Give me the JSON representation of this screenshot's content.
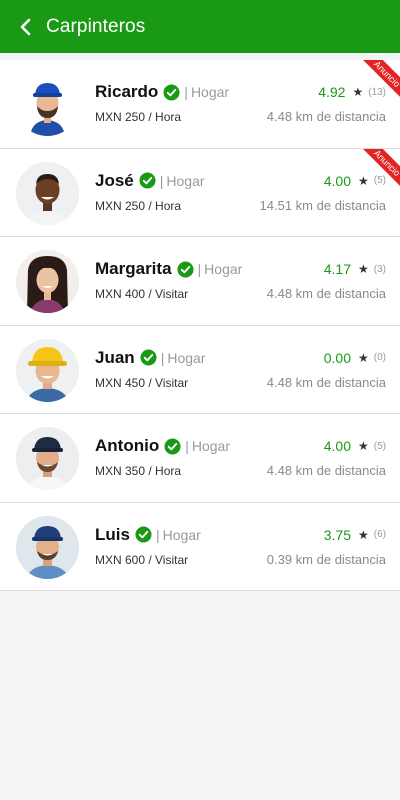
{
  "appbar": {
    "title": "Carpinteros"
  },
  "colors": {
    "brand_green": "#1a9a14",
    "ribbon_red": "#e32424"
  },
  "providers": [
    {
      "name": "Ricardo",
      "category": "Hogar",
      "separator": "|",
      "price": "MXN 250 / Hora",
      "score": "4.92",
      "star": "★",
      "count": "(13)",
      "distance": "4.48 km de distancia",
      "ribbon": "Anuncio"
    },
    {
      "name": "José",
      "category": "Hogar",
      "separator": "|",
      "price": "MXN 250 / Hora",
      "score": "4.00",
      "star": "★",
      "count": "(5)",
      "distance": "14.51 km de distancia",
      "ribbon": "Anuncio"
    },
    {
      "name": "Margarita",
      "category": "Hogar",
      "separator": "|",
      "price": "MXN 400 / Visitar",
      "score": "4.17",
      "star": "★",
      "count": "(3)",
      "distance": "4.48 km de distancia"
    },
    {
      "name": "Juan",
      "category": "Hogar",
      "separator": "|",
      "price": "MXN 450 / Visitar",
      "score": "0.00",
      "star": "★",
      "count": "(0)",
      "distance": "4.48 km de distancia"
    },
    {
      "name": "Antonio",
      "category": "Hogar",
      "separator": "|",
      "price": "MXN 350 / Hora",
      "score": "4.00",
      "star": "★",
      "count": "(5)",
      "distance": "4.48 km de distancia"
    },
    {
      "name": "Luis",
      "category": "Hogar",
      "separator": "|",
      "price": "MXN 600 / Visitar",
      "score": "3.75",
      "star": "★",
      "count": "(6)",
      "distance": "0.39 km de distancia"
    }
  ]
}
